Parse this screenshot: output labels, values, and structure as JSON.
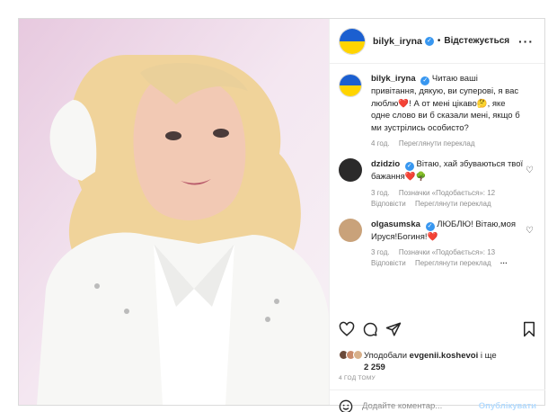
{
  "post": {
    "username": "bilyk_iryna",
    "follow_label": "Відстежується",
    "caption_name": "bilyk_iryna",
    "caption": "Читаю ваші привітання, дякую, ви суперові, я вас люблю❤️! А от мені цікаво🤔, яке одне слово ви б сказали мені, якщо б ми зустрілись особисто?",
    "caption_time": "4 год.",
    "caption_translate": "Переглянути переклад"
  },
  "comments": [
    {
      "name": "dzidzio",
      "text": "Вітаю, хай збуваються твої бажання❤️🌳",
      "time": "3 год.",
      "likes": "Позначки «Подобається»: 12",
      "reply": "Відповісти",
      "translate": "Переглянути переклад"
    },
    {
      "name": "olgasumska",
      "text": "ЛЮБЛЮ! Вітаю,моя Ируся!Богиня!❤️",
      "time": "3 год.",
      "likes": "Позначки «Подобається»: 13",
      "reply": "Відповісти",
      "translate": "Переглянути переклад"
    }
  ],
  "likes": {
    "prefix": "Уподобали",
    "user": "evgenii.koshevoi",
    "suffix": "і ще",
    "count": "2 259"
  },
  "timestamp": "4 ГОД ТОМУ",
  "comment_box": {
    "placeholder": "Додайте коментар...",
    "publish": "Опублікувати"
  },
  "colors": {
    "accent": "#3897f0",
    "flag_blue": "#1b5fd0",
    "flag_yellow": "#ffd400"
  }
}
